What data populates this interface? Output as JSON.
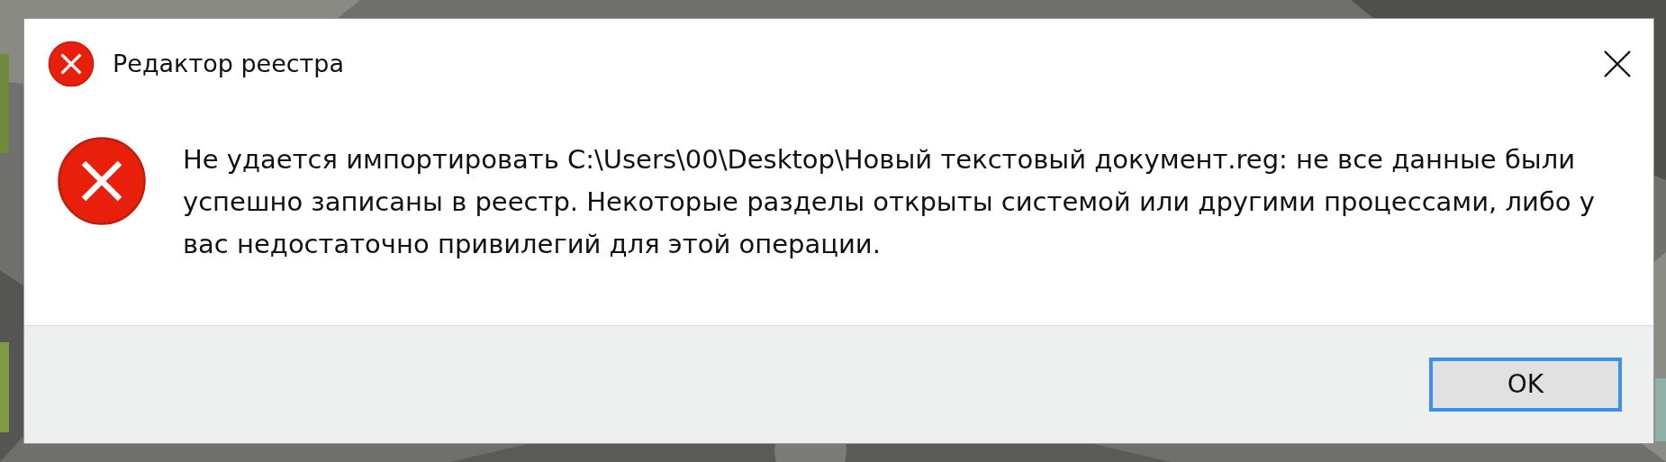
{
  "window": {
    "title": "Редактор реестра"
  },
  "message": "Не удается импортировать C:\\Users\\00\\Desktop\\Новый текстовый документ.reg: не все данные были успешно записаны в реестр. Некоторые разделы открыты системой или другими процессами, либо у вас недостаточно привилегий для этой операции.",
  "buttons": [
    {
      "label": "OK",
      "selected": true
    }
  ]
}
